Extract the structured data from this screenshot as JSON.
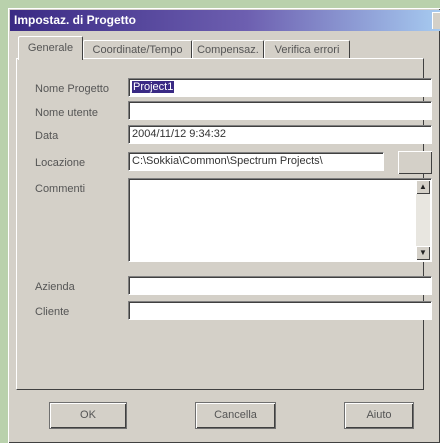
{
  "window": {
    "title": "Impostaz. di Progetto"
  },
  "tabs": [
    {
      "label": "Generale",
      "active": true
    },
    {
      "label": "Coordinate/Tempo",
      "active": false
    },
    {
      "label": "Compensaz.",
      "active": false
    },
    {
      "label": "Verifica errori",
      "active": false
    }
  ],
  "form": {
    "project_name_label": "Nome Progetto",
    "project_name_value": "Project1",
    "user_name_label": "Nome utente",
    "user_name_value": "",
    "date_label": "Data",
    "date_value": "2004/11/12  9:34:32",
    "location_label": "Locazione",
    "location_value": "C:\\Sokkia\\Common\\Spectrum Projects\\",
    "comments_label": "Commenti",
    "comments_value": "",
    "company_label": "Azienda",
    "company_value": "",
    "client_label": "Cliente",
    "client_value": ""
  },
  "buttons": {
    "ok": "OK",
    "cancel": "Cancella",
    "help": "Aiuto"
  },
  "icons": {
    "scroll_up": "scroll-up-arrow-icon",
    "scroll_down": "scroll-down-arrow-icon"
  },
  "colors": {
    "titlebar_start": "#3a2a84",
    "titlebar_end": "#a6caf0",
    "dialog_face": "#d4d0c8",
    "selection": "#3a2a84"
  }
}
